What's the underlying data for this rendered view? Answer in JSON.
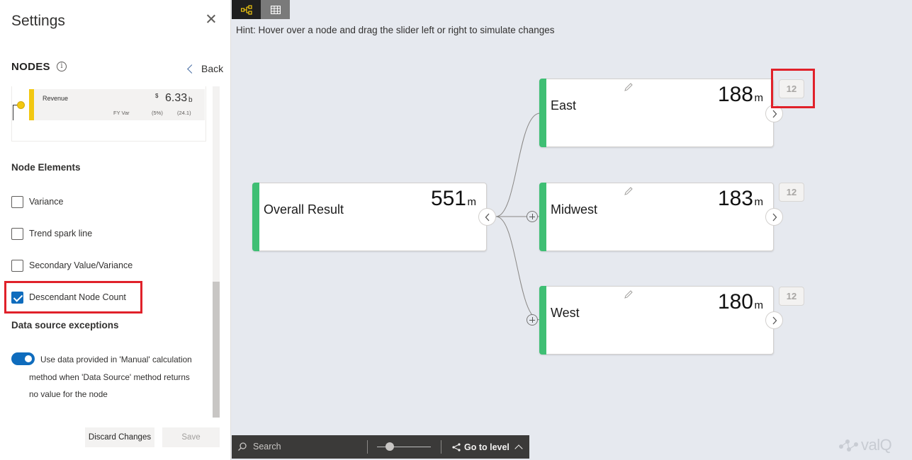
{
  "settings": {
    "title": "Settings",
    "section": "NODES",
    "back_label": "Back",
    "preview": {
      "label": "Revenue",
      "currency": "$",
      "value": "6.33",
      "unit": "b",
      "fy_label": "FY Var",
      "pct": "(5%)",
      "delta": "(24.1)",
      "accent": "#f2c811"
    },
    "node_elements_title": "Node Elements",
    "options": [
      {
        "label": "Variance",
        "checked": false
      },
      {
        "label": "Trend spark line",
        "checked": false
      },
      {
        "label": "Secondary Value/Variance",
        "checked": false
      },
      {
        "label": "Descendant Node Count",
        "checked": true
      }
    ],
    "exceptions_title": "Data source exceptions",
    "toggle_line1": "Use data provided in 'Manual' calculation",
    "toggle_line2": "method when 'Data Source' method returns",
    "toggle_line3": "no value for the node",
    "toggle_on": true,
    "discard_label": "Discard Changes",
    "save_label": "Save"
  },
  "canvas": {
    "tabs": [
      {
        "icon": "tree-view-icon"
      },
      {
        "icon": "table-view-icon"
      }
    ],
    "hint": "Hint: Hover over a node and drag the slider left or right to simulate changes",
    "nodes": {
      "root": {
        "name": "Overall Result",
        "value": "551",
        "unit": "m"
      },
      "east": {
        "name": "East",
        "value": "188",
        "unit": "m",
        "count": "12"
      },
      "midwest": {
        "name": "Midwest",
        "value": "183",
        "unit": "m",
        "count": "12"
      },
      "west": {
        "name": "West",
        "value": "180",
        "unit": "m",
        "count": "12"
      }
    },
    "node_color": "#3fbf74",
    "highlight_color": "#e0212a"
  },
  "toolbar": {
    "search_placeholder": "Search",
    "goto_label": "Go to level"
  },
  "brand": {
    "logo_text": "valQ"
  }
}
